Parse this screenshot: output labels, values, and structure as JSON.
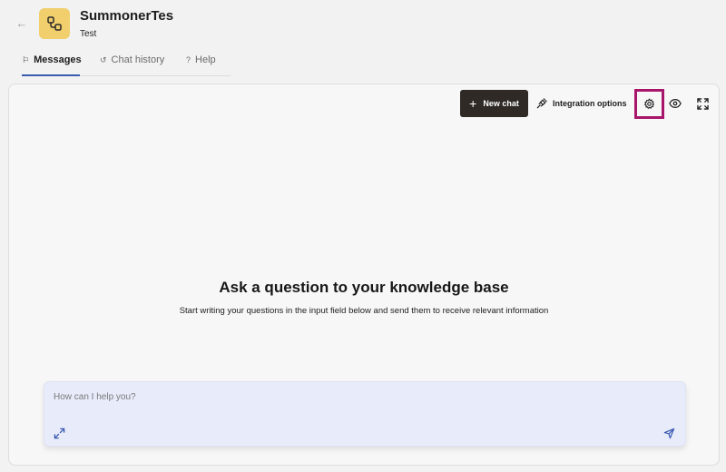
{
  "header": {
    "back_icon": "arrow-left-icon",
    "app_icon": "nodes-icon",
    "title": "SummonerTes",
    "subtitle": "Test"
  },
  "tabs": [
    {
      "label": "Messages",
      "icon": "flag-icon",
      "active": true
    },
    {
      "label": "Chat history",
      "icon": "history-icon",
      "active": false
    },
    {
      "label": "Help",
      "icon": "help-circle-icon",
      "active": false
    }
  ],
  "toolbar": {
    "new_chat_label": "New chat",
    "integration_label": "Integration options",
    "settings_icon": "gear-icon",
    "preview_icon": "eye-icon",
    "fullscreen_icon": "expand-icon"
  },
  "empty_state": {
    "heading": "Ask a question to your knowledge base",
    "subtext": "Start writing your questions in the input field below and send them to receive relevant information"
  },
  "composer": {
    "placeholder": "How can I help you?",
    "value": ""
  },
  "colors": {
    "accent": "#3b5bb0",
    "app_icon_bg": "#f1cf6c",
    "new_chat_bg": "#2f2a26",
    "highlight_border": "#a8166b",
    "composer_bg": "#e7ebfa"
  }
}
